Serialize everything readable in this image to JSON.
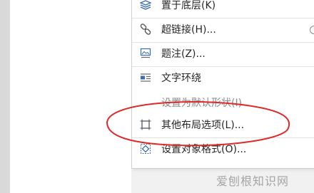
{
  "context_menu": {
    "items": [
      {
        "label": "置于底层(K)",
        "icon": "send-to-back-icon"
      },
      {
        "label": "超链接(H)...",
        "icon": "link-icon"
      },
      {
        "label": "题注(Z)...",
        "icon": "caption-icon"
      },
      {
        "label": "文字环绕",
        "icon": "text-wrap-icon"
      },
      {
        "label": "设置为默认形状(I)",
        "icon": ""
      },
      {
        "label": "其他布局选项(L)...",
        "icon": "layout-options-icon"
      },
      {
        "label": "设置对象格式(O)...",
        "icon": "format-object-icon"
      }
    ]
  },
  "annotation": {
    "color": "#e02a2a"
  },
  "watermark": {
    "text": "爱刨根知识网"
  }
}
